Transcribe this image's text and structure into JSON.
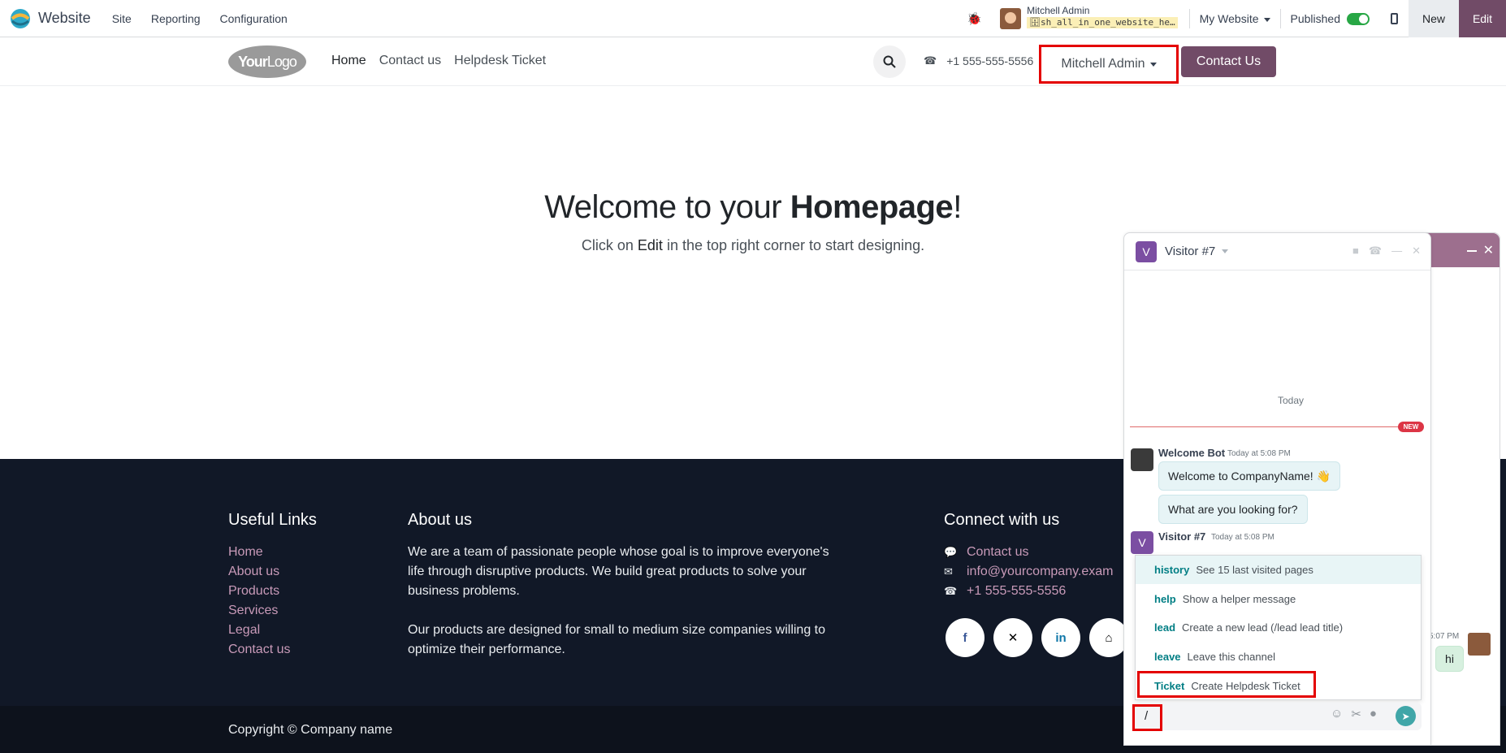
{
  "admin_bar": {
    "app_name": "Website",
    "menu": [
      "Site",
      "Reporting",
      "Configuration"
    ],
    "user_name": "Mitchell Admin",
    "database": "sh_all_in_one_website_he…",
    "website_switch": "My Website",
    "published_label": "Published",
    "published": true,
    "new_label": "New",
    "edit_label": "Edit"
  },
  "site_header": {
    "logo_text_bold": "Your",
    "logo_text_light": "Logo",
    "nav": [
      "Home",
      "Contact us",
      "Helpdesk Ticket"
    ],
    "phone": "+1 555-555-5556",
    "user_dropdown": "Mitchell Admin",
    "contact_button": "Contact Us"
  },
  "hero": {
    "title_prefix": "Welcome to your ",
    "title_bold": "Homepage",
    "title_suffix": "!",
    "subtitle_prefix": "Click on ",
    "subtitle_bold": "Edit",
    "subtitle_suffix": " in the top right corner to start designing."
  },
  "footer": {
    "useful_links_title": "Useful Links",
    "useful_links": [
      "Home",
      "About us",
      "Products",
      "Services",
      "Legal",
      "Contact us"
    ],
    "about_title": "About us",
    "about_p1": "We are a team of passionate people whose goal is to improve everyone's life through disruptive products. We build great products to solve your business problems.",
    "about_p2": "Our products are designed for small to medium size companies willing to optimize their performance.",
    "connect_title": "Connect with us",
    "contact_link": "Contact us",
    "email": "info@yourcompany.exam",
    "phone": "+1 555-555-5556",
    "copyright": "Copyright © Company name"
  },
  "chat": {
    "visitor_initial": "V",
    "title": "Visitor #7",
    "today_label": "Today",
    "new_badge": "NEW",
    "bot_name": "Welcome Bot",
    "bot_time": "Today at 5:08 PM",
    "bot_messages": [
      "Welcome to CompanyName! 👋",
      "What are you looking for?"
    ],
    "visitor_name": "Visitor #7",
    "visitor_time": "Today at 5:08 PM",
    "commands": [
      {
        "name": "history",
        "desc": "See 15 last visited pages"
      },
      {
        "name": "help",
        "desc": "Show a helper message"
      },
      {
        "name": "lead",
        "desc": "Create a new lead (/lead lead title)"
      },
      {
        "name": "leave",
        "desc": "Leave this channel"
      },
      {
        "name": "Ticket",
        "desc": "Create Helpdesk Ticket"
      }
    ],
    "input_value": "/",
    "bg_time": "5:07 PM",
    "bg_message": "hi"
  }
}
